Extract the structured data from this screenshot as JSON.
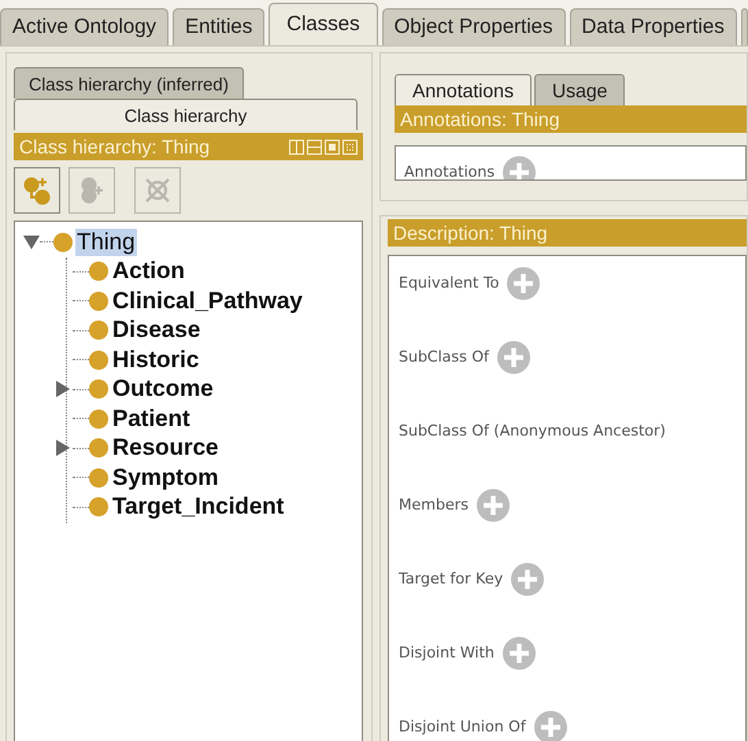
{
  "main_tabs": [
    {
      "label": "Active Ontology",
      "selected": false
    },
    {
      "label": "Entities",
      "selected": false
    },
    {
      "label": "Classes",
      "selected": true
    },
    {
      "label": "Object Properties",
      "selected": false
    },
    {
      "label": "Data Properties",
      "selected": false
    }
  ],
  "left_panel": {
    "tabs": [
      {
        "label": "Class hierarchy (inferred)",
        "selected": false
      },
      {
        "label": "Class hierarchy",
        "selected": true
      }
    ],
    "view_title": "Class hierarchy: Thing",
    "toolbar": [
      {
        "kind": "add-subclass",
        "disabled": false
      },
      {
        "kind": "add-sibling",
        "disabled": true
      },
      {
        "kind": "delete",
        "disabled": true
      }
    ],
    "tree": [
      {
        "label": "Thing",
        "selected": true,
        "expanded": true,
        "children": [
          {
            "label": "Action",
            "selected": false
          },
          {
            "label": "Clinical_Pathway",
            "selected": false
          },
          {
            "label": "Disease",
            "selected": false
          },
          {
            "label": "Historic",
            "selected": false
          },
          {
            "label": "Outcome",
            "selected": false,
            "expanded": false
          },
          {
            "label": "Patient",
            "selected": false
          },
          {
            "label": "Resource",
            "selected": false,
            "expanded": false
          },
          {
            "label": "Symptom",
            "selected": false
          },
          {
            "label": "Target_Incident",
            "selected": false
          }
        ]
      }
    ]
  },
  "right_panel": {
    "tabs": [
      {
        "label": "Annotations",
        "selected": true
      },
      {
        "label": "Usage",
        "selected": false
      }
    ],
    "annotations_title": "Annotations: Thing",
    "annotations": [
      {
        "label": "Annotations",
        "has_add": true
      }
    ],
    "description_title": "Description: Thing",
    "description": [
      {
        "label": "Equivalent To",
        "has_add": true
      },
      {
        "label": "SubClass Of",
        "has_add": true
      },
      {
        "label": "SubClass Of (Anonymous Ancestor)",
        "has_add": false
      },
      {
        "label": "Members",
        "has_add": true
      },
      {
        "label": "Target for Key",
        "has_add": true
      },
      {
        "label": "Disjoint With",
        "has_add": true
      },
      {
        "label": "Disjoint Union Of",
        "has_add": true
      }
    ]
  }
}
